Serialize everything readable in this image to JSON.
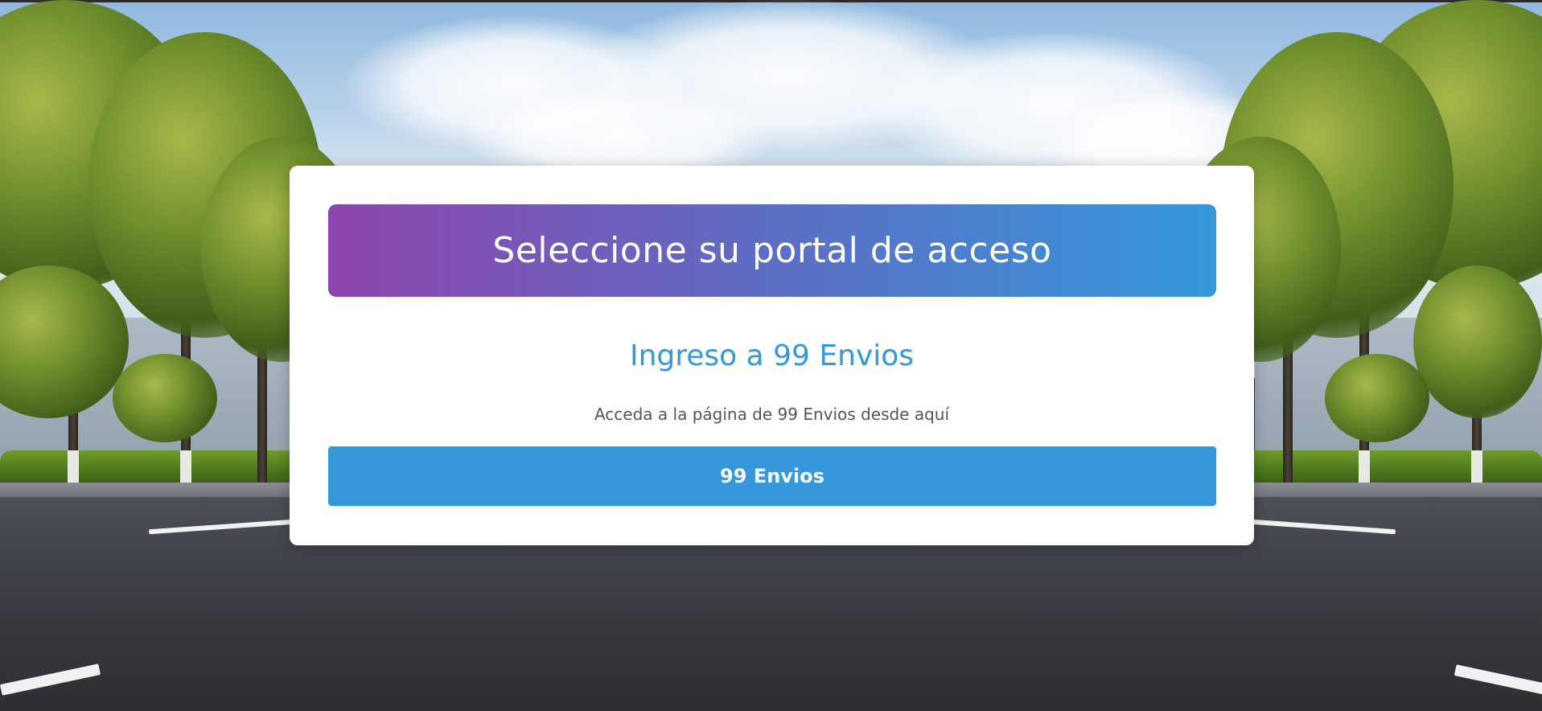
{
  "header": {
    "title": "Seleccione su portal de acceso"
  },
  "portal": {
    "title": "Ingreso a 99 Envios",
    "description": "Acceda a la página de 99 Envios desde aquí",
    "button_label": "99 Envios"
  },
  "colors": {
    "gradient_start": "#8e44ad",
    "gradient_end": "#3498db",
    "accent": "#3498db",
    "card_background": "#ffffff",
    "description_text": "#555555"
  }
}
